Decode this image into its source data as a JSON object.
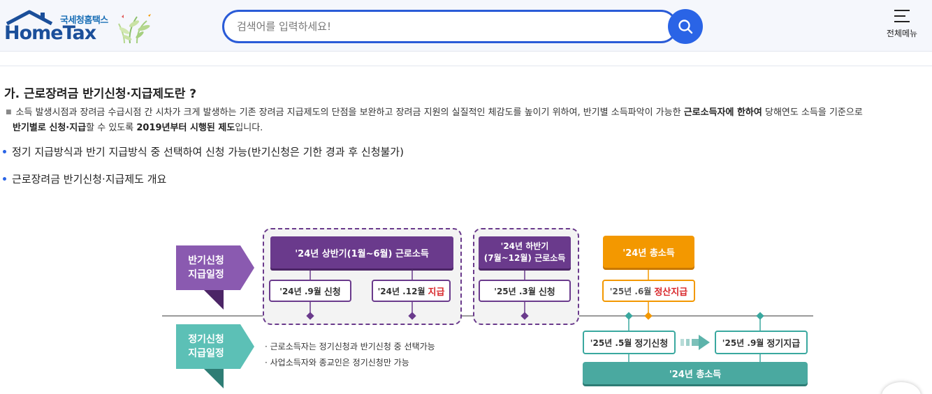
{
  "header": {
    "logo_kr": "국세청홈택스",
    "logo_en": "HomeTax",
    "search_placeholder": "검색어를 입력하세요!",
    "menu_label": "전체메뉴",
    "colors": {
      "brand": "#1b4f9a",
      "search_accent": "#2a64e6"
    }
  },
  "content": {
    "heading": "가. 근로장려금 반기신청·지급제도란 ?",
    "para": {
      "p1": "소득 발생시점과 장려금 수급시점 간 시차가 크게 발생하는 기존 장려금 지급제도의 단점을 보완하고 장려금 지원의 실질적인 체감도를 높이기 위하여, 반기별 소득파악이 가능한 ",
      "b1": "근로소득자에 한하여",
      "p2": " 당해연도 소득을 기준으로 ",
      "b2": "반기별로 신청·지급",
      "p3": "할 수 있도록 ",
      "b3": "2019년부터 시행된 제도",
      "p4": "입니다."
    },
    "bullets": [
      "정기 지급방식과 반기 지급방식 중 선택하여 신청 가능(반기신청은 기한 경과 후 신청불가)",
      "근로장려금 반기신청·지급제도 개요"
    ]
  },
  "diagram": {
    "half_label": "반기신청\n지급일정",
    "regular_label": "정기신청\n지급일정",
    "first_half_income": "'24년 상반기(1월~6월) 근로소득",
    "second_half_income": "'24년 하반기\n(7월~12월) 근로소득",
    "total_income_top": "'24년 총소득",
    "apply_sep": {
      "date": "'24년 .9월",
      "action": "신청"
    },
    "pay_dec": {
      "date": "'24년 .12월",
      "action": "지급"
    },
    "apply_mar": {
      "date": "'25년 .3월",
      "action": "신청"
    },
    "settle_jun": {
      "date": "'25년 .6월",
      "action": "정산지급"
    },
    "reg_apply_may": {
      "date": "'25년 .5월",
      "action": "정기신청"
    },
    "reg_pay_sep": {
      "date": "'25년 .9월",
      "action": "정기지급"
    },
    "total_income_bottom": "'24년 총소득",
    "notes": [
      "· 근로소득자는 정기신청과 반기신청 중 선택가능",
      "· 사업소득자와 종교인은 정기신청만 가능"
    ],
    "colors": {
      "purple": "#6a3a8c",
      "orange": "#f39800",
      "teal": "#4aa9a0",
      "red": "#d8262a"
    }
  }
}
